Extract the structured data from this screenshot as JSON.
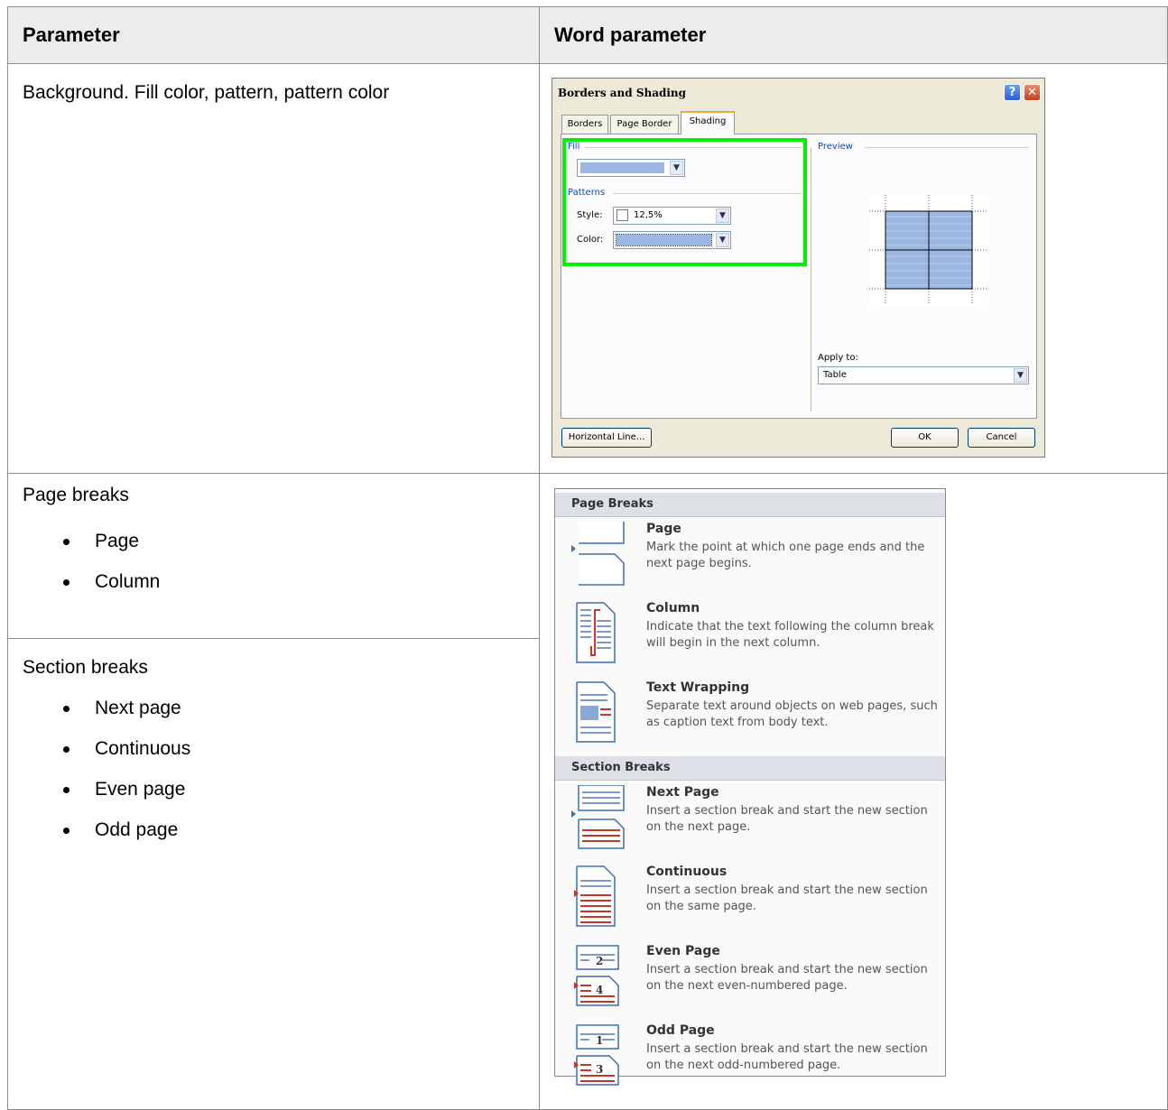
{
  "table": {
    "header": {
      "parameter": "Parameter",
      "word_parameter": "Word parameter"
    },
    "rows": [
      {
        "parameter": "Background. Fill color, pattern, pattern color"
      },
      {
        "parameter": "Page breaks",
        "items": [
          "Page",
          "Column"
        ]
      },
      {
        "parameter": "Section breaks",
        "items": [
          "Next page",
          "Continuous",
          "Even page",
          "Odd page"
        ]
      }
    ]
  },
  "dialog": {
    "title": "Borders and Shading",
    "help_glyph": "?",
    "close_glyph": "✕",
    "tabs": [
      "Borders",
      "Page Border",
      "Shading"
    ],
    "active_tab": "Shading",
    "fill_group": "Fill",
    "patterns_group": "Patterns",
    "style_label": "Style:",
    "style_value": "12,5%",
    "color_label": "Color:",
    "preview_group": "Preview",
    "apply_to_label": "Apply to:",
    "apply_to_value": "Table",
    "horizontal_line_button": "Horizontal Line...",
    "ok_button": "OK",
    "cancel_button": "Cancel",
    "fill_color": "#9cb8e2",
    "highlight_color": "#00f200"
  },
  "breaks_menu": {
    "page_breaks_header": "Page Breaks",
    "section_breaks_header": "Section Breaks",
    "items": [
      {
        "title": "Page",
        "description": "Mark the point at which one page ends and the next page begins.",
        "icon": "page-break-icon"
      },
      {
        "title": "Column",
        "description": "Indicate that the text following the column break will begin in the next column.",
        "icon": "column-break-icon"
      },
      {
        "title": "Text Wrapping",
        "description": "Separate text around objects on web pages, such as caption text from body text.",
        "icon": "text-wrapping-icon"
      },
      {
        "title": "Next Page",
        "description": "Insert a section break and start the new section on the next page.",
        "icon": "next-page-break-icon"
      },
      {
        "title": "Continuous",
        "description": "Insert a section break and start the new section on the same page.",
        "icon": "continuous-break-icon"
      },
      {
        "title": "Even Page",
        "description": "Insert a section break and start the new section on the next even-numbered page.",
        "icon": "even-page-break-icon",
        "numbers": [
          "2",
          "4"
        ]
      },
      {
        "title": "Odd Page",
        "description": "Insert a section break and start the new section on the next odd-numbered page.",
        "icon": "odd-page-break-icon",
        "numbers": [
          "1",
          "3"
        ]
      }
    ]
  }
}
